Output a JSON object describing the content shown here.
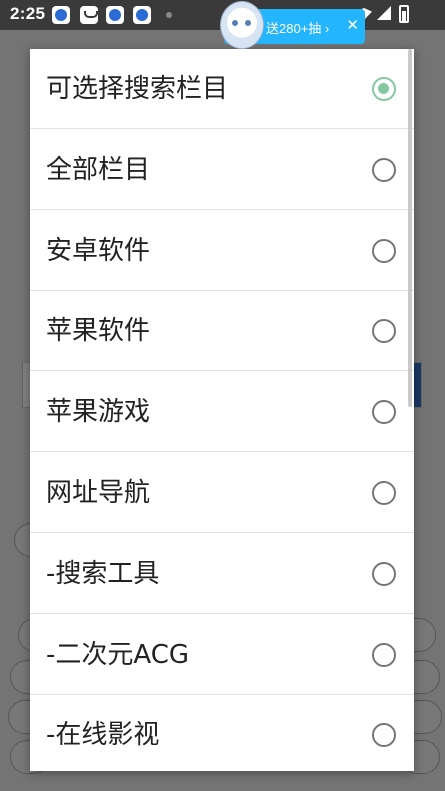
{
  "status_bar": {
    "time": "2:25"
  },
  "promo": {
    "text": "送280+抽 ›",
    "close": "✕"
  },
  "dialog": {
    "options": [
      {
        "label": "可选择搜索栏目",
        "selected": true
      },
      {
        "label": "全部栏目",
        "selected": false
      },
      {
        "label": "安卓软件",
        "selected": false
      },
      {
        "label": "苹果软件",
        "selected": false
      },
      {
        "label": "苹果游戏",
        "selected": false
      },
      {
        "label": "网址导航",
        "selected": false
      },
      {
        "label": "-搜索工具",
        "selected": false
      },
      {
        "label": "-二次元ACG",
        "selected": false
      },
      {
        "label": "-在线影视",
        "selected": false
      }
    ]
  },
  "colors": {
    "accent": "#82c9a2",
    "promo": "#24b5ff",
    "status_bar": "#3a3a3a"
  }
}
